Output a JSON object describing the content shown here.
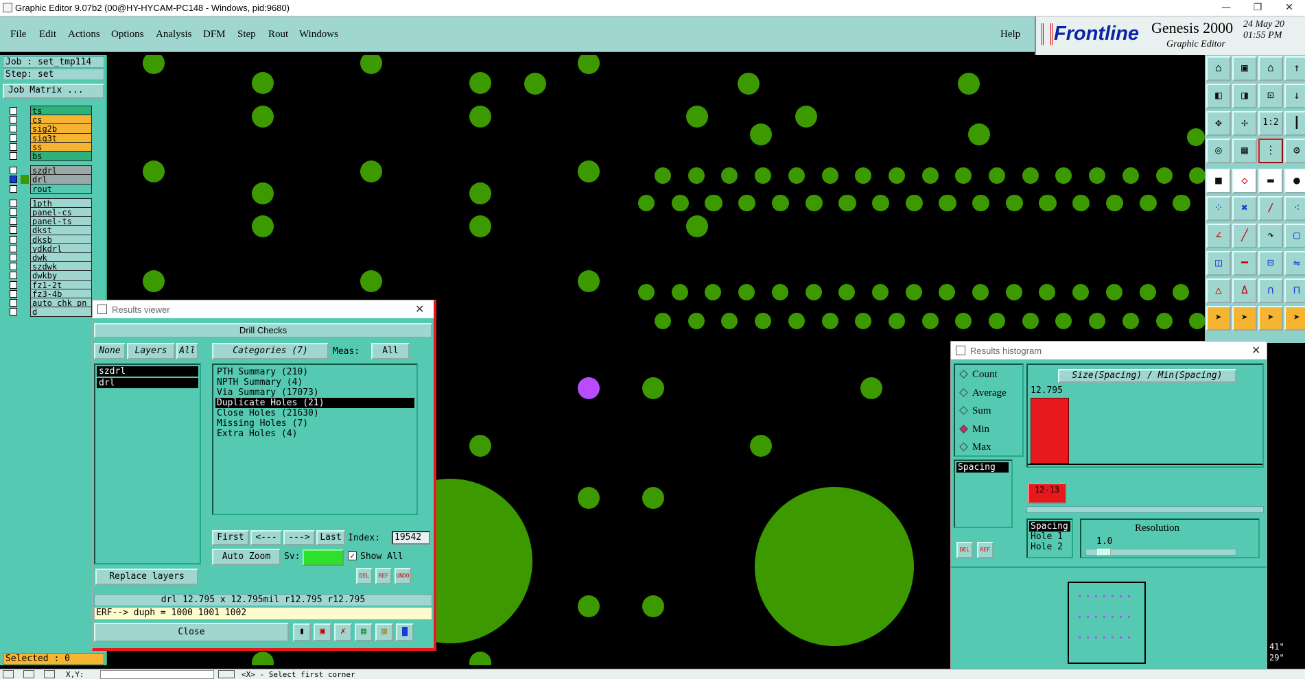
{
  "window": {
    "title": "Graphic Editor 9.07b2 (00@HY-HYCAM-PC148 - Windows, pid:9680)",
    "min": "—",
    "restore": "❐",
    "close": "✕"
  },
  "menus": [
    "File",
    "Edit",
    "Actions",
    "Options",
    "Analysis",
    "DFM",
    "Step",
    "Rout",
    "Windows"
  ],
  "menu_help": "Help",
  "brand": {
    "logo": "Frontline",
    "product": "Genesis 2000",
    "sub": "Graphic Editor",
    "date": "24 May 20",
    "time": "01:55 PM"
  },
  "left": {
    "job": "Job : set_tmp114",
    "step": "Step: set",
    "job_matrix": "Job Matrix ...",
    "selected": "Selected : 0",
    "layers": [
      {
        "name": "ts",
        "color": "#2db37a"
      },
      {
        "name": "cs",
        "color": "#f5b431"
      },
      {
        "name": "sig2b",
        "color": "#f5b431"
      },
      {
        "name": "sig3t",
        "color": "#f5b431"
      },
      {
        "name": "ss",
        "color": "#f5b431"
      },
      {
        "name": "bs",
        "color": "#2db37a"
      },
      {
        "name": "szdrl",
        "color": "#9aa8a8"
      },
      {
        "name": "drl",
        "color": "#9aa8a8"
      },
      {
        "name": "rout",
        "color": "#56c9b2"
      },
      {
        "name": "1pth",
        "color": "#9fd6d0"
      },
      {
        "name": "panel-cs",
        "color": "#9fd6d0"
      },
      {
        "name": "panel-ts",
        "color": "#9fd6d0"
      },
      {
        "name": "dkst",
        "color": "#9fd6d0"
      },
      {
        "name": "dksb",
        "color": "#9fd6d0"
      },
      {
        "name": "ydkdrl",
        "color": "#9fd6d0"
      },
      {
        "name": "dwk",
        "color": "#9fd6d0"
      },
      {
        "name": "szdwk",
        "color": "#9fd6d0"
      },
      {
        "name": "dwkby",
        "color": "#9fd6d0"
      },
      {
        "name": "fz1-2t",
        "color": "#9fd6d0"
      },
      {
        "name": "fz3-4b",
        "color": "#9fd6d0"
      },
      {
        "name": "auto_chk_pn",
        "color": "#9fd6d0"
      },
      {
        "name": "d",
        "color": "#9fd6d0"
      }
    ]
  },
  "results": {
    "title": "Results viewer",
    "header": "Drill Checks",
    "none": "None",
    "layers_btn": "Layers",
    "all": "All",
    "categories_btn": "Categories (7)",
    "meas_label": "Meas:",
    "meas_val": "All",
    "layer_list": [
      "szdrl",
      "drl"
    ],
    "categories": [
      "PTH Summary (210)",
      "NPTH Summary (4)",
      "Via Summary (17073)",
      "Duplicate Holes (21)",
      "Close Holes (21630)",
      "Missing Holes (7)",
      "Extra Holes (4)"
    ],
    "first": "First",
    "prev": "<---",
    "next": "--->",
    "last": "Last",
    "index_label": "Index:",
    "index_val": "19542",
    "auto_zoom": "Auto Zoom",
    "sv": "Sv:",
    "show_all": "Show All",
    "replace": "Replace layers",
    "ico_del": "DEL",
    "ico_ref": "REF",
    "ico_undo": "UNDO",
    "info": "drl 12.795 x 12.795mil  r12.795  r12.795",
    "erf": "ERF--> duph = 1000 1001 1002",
    "close": "Close"
  },
  "hist": {
    "title": "Results histogram",
    "modes": [
      "Count",
      "Average",
      "Sum",
      "Min",
      "Max"
    ],
    "selected_mode": "Min",
    "metric": "Spacing",
    "chart_title": "Size(Spacing) / Min(Spacing)",
    "bar_value": "12.795",
    "bin_label": "12-13",
    "fields": [
      "Spacing",
      "Hole 1",
      "Hole 2"
    ],
    "resolution_label": "Resolution",
    "resolution_val": "1.0",
    "ico_del": "DEL",
    "ico_ref": "REF"
  },
  "status": {
    "coord": "X,Y:",
    "prompt": "<X> - Select first corner",
    "right_a": "41\"",
    "right_b": "29\""
  },
  "colors": {
    "panel": "#56c9b2",
    "menubar": "#9fd6d0",
    "copper": "#3d9900",
    "highlight": "#b84dff",
    "bar": "#e8191c"
  }
}
